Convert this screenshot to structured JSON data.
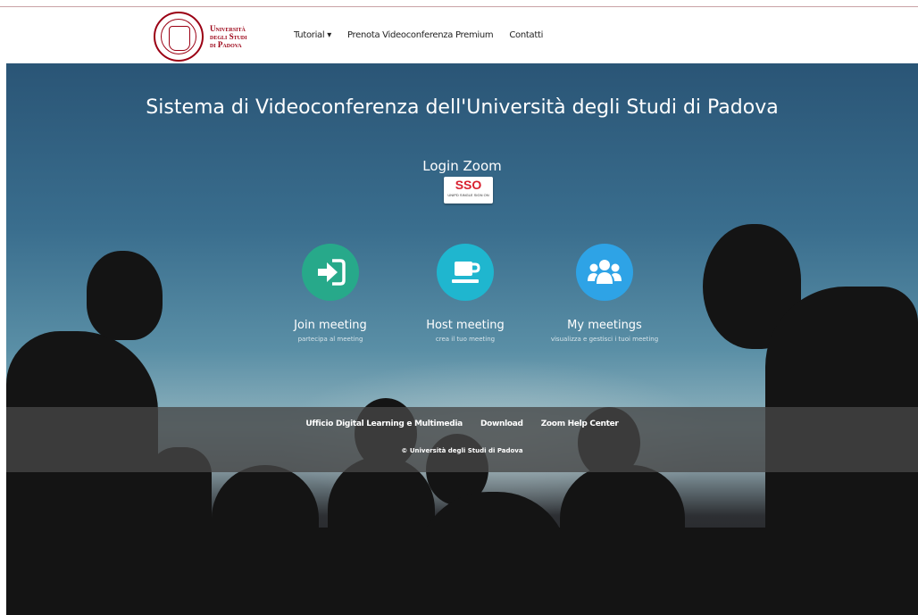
{
  "brand": {
    "line1": "Università",
    "line2": "degli Studi",
    "line3": "di Padova",
    "color": "#9b0014"
  },
  "nav": {
    "tutorial": "Tutorial",
    "premium": "Prenota Videoconferenza Premium",
    "contact": "Contatti"
  },
  "hero": {
    "title": "Sistema di Videoconferenza dell'Università degli Studi di Padova",
    "login_label": "Login Zoom",
    "sso_logo": "SSO",
    "sso_caption": "UNIPD SINGLE SIGN ON"
  },
  "tiles": [
    {
      "label": "Join meeting",
      "sub": "partecipa al meeting",
      "icon": "sign-in-icon",
      "color": "#27a98a"
    },
    {
      "label": "Host meeting",
      "sub": "crea il tuo meeting",
      "icon": "coffee-cup-icon",
      "color": "#1fb6cf"
    },
    {
      "label": "My meetings",
      "sub": "visualizza e gestisci i tuoi meeting",
      "icon": "users-icon",
      "color": "#2ea3e6"
    }
  ],
  "footer": {
    "links": [
      "Ufficio Digital Learning e Multimedia",
      "Download",
      "Zoom Help Center"
    ],
    "copyright": "© Università degli Studi di Padova"
  }
}
